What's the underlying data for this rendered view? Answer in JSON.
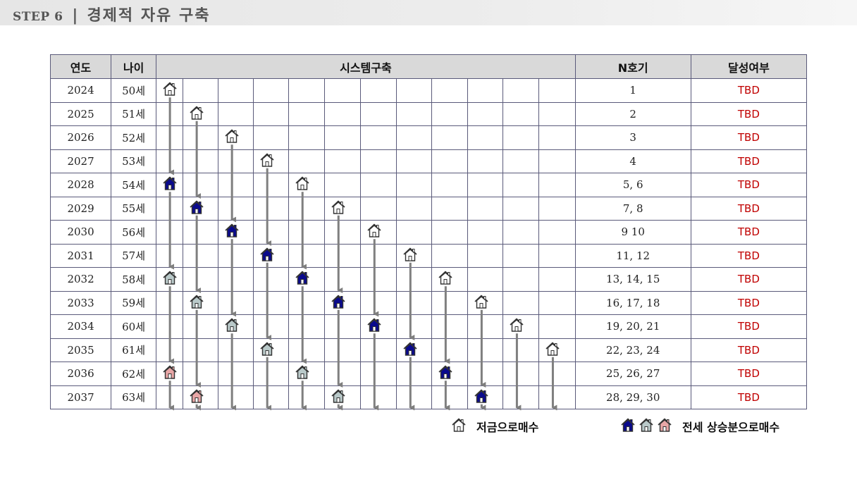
{
  "title": {
    "step": "STEP 6",
    "separator": "|",
    "main": "경제적 자유 구축"
  },
  "table": {
    "headers": {
      "year": "연도",
      "age": "나이",
      "system": "시스템구축",
      "n": "N호기",
      "status": "달성여부"
    },
    "rows": [
      {
        "year": "2024",
        "age": "50세",
        "n": "1",
        "status": "TBD"
      },
      {
        "year": "2025",
        "age": "51세",
        "n": "2",
        "status": "TBD"
      },
      {
        "year": "2026",
        "age": "52세",
        "n": "3",
        "status": "TBD"
      },
      {
        "year": "2027",
        "age": "53세",
        "n": "4",
        "status": "TBD"
      },
      {
        "year": "2028",
        "age": "54세",
        "n": "5, 6",
        "status": "TBD"
      },
      {
        "year": "2029",
        "age": "55세",
        "n": "7, 8",
        "status": "TBD"
      },
      {
        "year": "2030",
        "age": "56세",
        "n": "9 10",
        "status": "TBD"
      },
      {
        "year": "2031",
        "age": "57세",
        "n": "11, 12",
        "status": "TBD"
      },
      {
        "year": "2032",
        "age": "58세",
        "n": "13, 14, 15",
        "status": "TBD"
      },
      {
        "year": "2033",
        "age": "59세",
        "n": "16, 17, 18",
        "status": "TBD"
      },
      {
        "year": "2034",
        "age": "60세",
        "n": "19, 20, 21",
        "status": "TBD"
      },
      {
        "year": "2035",
        "age": "61세",
        "n": "22, 23, 24",
        "status": "TBD"
      },
      {
        "year": "2036",
        "age": "62세",
        "n": "25, 26, 27",
        "status": "TBD"
      },
      {
        "year": "2037",
        "age": "63세",
        "n": "28, 29, 30",
        "status": "TBD"
      }
    ],
    "system_columns": 12,
    "houses": [
      {
        "row": 0,
        "col": 0,
        "type": "savings"
      },
      {
        "row": 1,
        "col": 1,
        "type": "savings"
      },
      {
        "row": 2,
        "col": 2,
        "type": "savings"
      },
      {
        "row": 3,
        "col": 3,
        "type": "savings"
      },
      {
        "row": 4,
        "col": 4,
        "type": "savings"
      },
      {
        "row": 5,
        "col": 5,
        "type": "savings"
      },
      {
        "row": 6,
        "col": 6,
        "type": "savings"
      },
      {
        "row": 7,
        "col": 7,
        "type": "savings"
      },
      {
        "row": 8,
        "col": 8,
        "type": "savings"
      },
      {
        "row": 9,
        "col": 9,
        "type": "savings"
      },
      {
        "row": 10,
        "col": 10,
        "type": "savings"
      },
      {
        "row": 11,
        "col": 11,
        "type": "savings"
      },
      {
        "row": 4,
        "col": 0,
        "type": "blue"
      },
      {
        "row": 5,
        "col": 1,
        "type": "blue"
      },
      {
        "row": 6,
        "col": 2,
        "type": "blue"
      },
      {
        "row": 7,
        "col": 3,
        "type": "blue"
      },
      {
        "row": 8,
        "col": 4,
        "type": "blue"
      },
      {
        "row": 9,
        "col": 5,
        "type": "blue"
      },
      {
        "row": 10,
        "col": 6,
        "type": "blue"
      },
      {
        "row": 11,
        "col": 7,
        "type": "blue"
      },
      {
        "row": 12,
        "col": 8,
        "type": "blue"
      },
      {
        "row": 13,
        "col": 9,
        "type": "blue"
      },
      {
        "row": 8,
        "col": 0,
        "type": "gray"
      },
      {
        "row": 9,
        "col": 1,
        "type": "gray"
      },
      {
        "row": 10,
        "col": 2,
        "type": "gray"
      },
      {
        "row": 11,
        "col": 3,
        "type": "gray"
      },
      {
        "row": 12,
        "col": 4,
        "type": "gray"
      },
      {
        "row": 13,
        "col": 5,
        "type": "gray"
      },
      {
        "row": 12,
        "col": 0,
        "type": "pink"
      },
      {
        "row": 13,
        "col": 1,
        "type": "pink"
      }
    ]
  },
  "legend": {
    "savings_label": "저금으로매수",
    "jeonse_label": "전세 상승분으로매수"
  },
  "colors": {
    "savings": "#ffffff",
    "blue": "#0a0a8c",
    "gray": "#b9c9c9",
    "pink": "#e8a6a6",
    "arrow": "#7f7f7f",
    "tbd": "#c00000"
  }
}
